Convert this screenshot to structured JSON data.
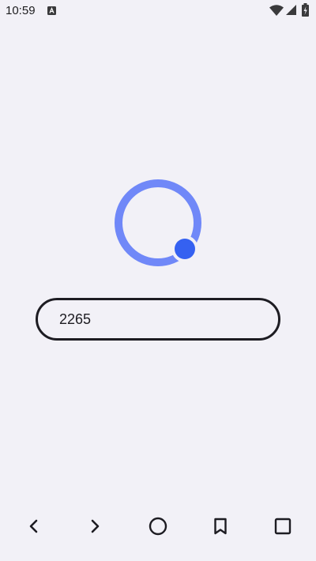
{
  "status_bar": {
    "time": "10:59",
    "notification_icon": "a11y-a-icon",
    "wifi_icon": "wifi-icon",
    "signal_icon": "cell-signal-icon",
    "battery_icon": "battery-icon"
  },
  "loader": {
    "icon": "loading-spinner-icon",
    "ring_color": "#7088f8",
    "dot_color": "#3561f1"
  },
  "input": {
    "value": "2265"
  },
  "nav": {
    "back_icon": "chevron-left-icon",
    "forward_icon": "chevron-right-icon",
    "home_icon": "circle-home-icon",
    "bookmark_icon": "bookmark-icon",
    "tabs_icon": "square-tabs-icon"
  },
  "colors": {
    "background": "#f2f1f7",
    "text": "#1d1c22"
  }
}
